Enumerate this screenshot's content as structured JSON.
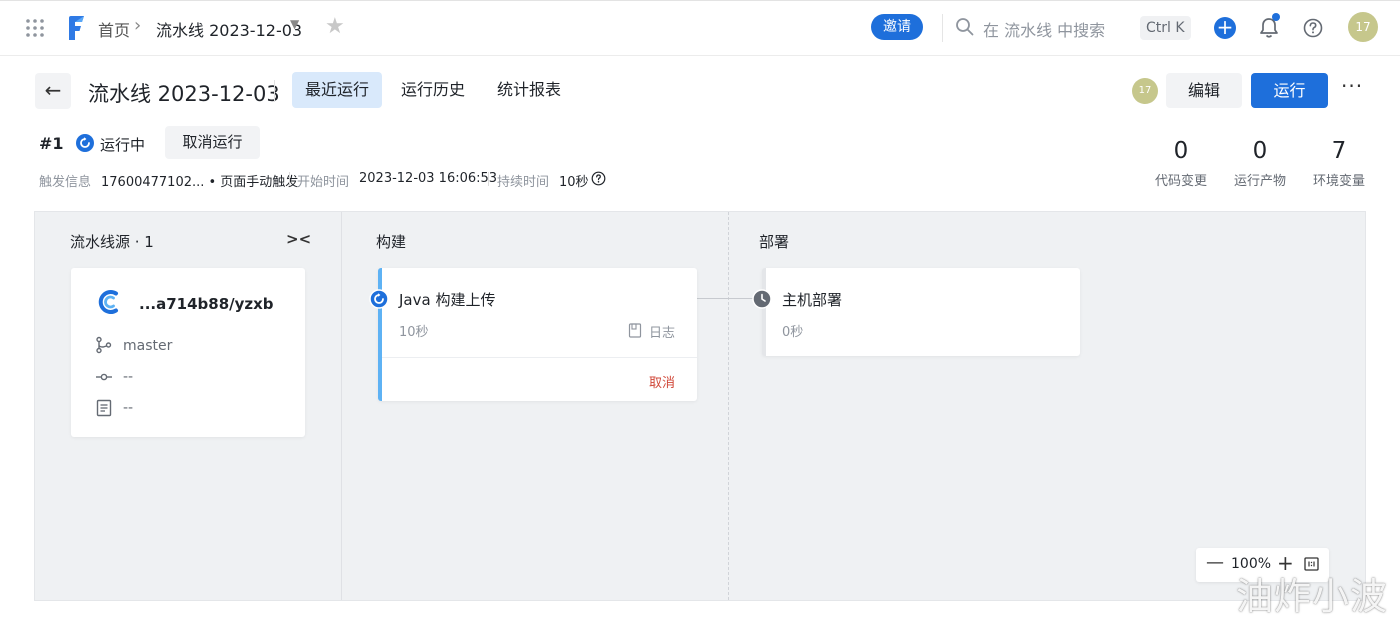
{
  "topbar": {
    "breadcrumb_home": "首页",
    "breadcrumb_separator": "›",
    "breadcrumb_current": "流水线 2023-12-03",
    "invite_label": "邀请",
    "search_placeholder": "在 流水线 中搜索",
    "shortcut": "Ctrl K",
    "add_label": "+",
    "avatar_text": "17",
    "accent_color": "#1e6fdb"
  },
  "header": {
    "back_label": "←",
    "title": "流水线 2023-12-03",
    "tabs": [
      {
        "label": "最近运行",
        "active": true
      },
      {
        "label": "运行历史",
        "active": false
      },
      {
        "label": "统计报表",
        "active": false
      }
    ],
    "avatar_text": "17",
    "edit_label": "编辑",
    "run_label": "运行",
    "more_label": "···"
  },
  "run": {
    "number": "#1",
    "status": "运行中",
    "cancel_label": "取消运行",
    "trigger_label": "触发信息",
    "trigger_value": "17600477102... • 页面手动触发",
    "start_label": "开始时间",
    "start_value": "2023-12-03 16:06:53",
    "duration_label": "持续时间",
    "duration_value": "10秒",
    "stats": [
      {
        "value": "0",
        "label": "代码变更"
      },
      {
        "value": "0",
        "label": "运行产物"
      },
      {
        "value": "7",
        "label": "环境变量"
      }
    ]
  },
  "pipeline": {
    "columns": [
      {
        "title": "流水线源 · 1",
        "collapse_icon": "><"
      },
      {
        "title": "构建"
      },
      {
        "title": "部署"
      }
    ],
    "source": {
      "repo_name": "...a714b88/yzxb",
      "branch": "master",
      "commit": "--",
      "message": "--"
    },
    "build_job": {
      "title": "Java 构建上传",
      "duration": "10秒",
      "log_label": "日志",
      "cancel_label": "取消",
      "status": "running"
    },
    "deploy_job": {
      "title": "主机部署",
      "duration": "0秒",
      "status": "pending"
    },
    "zoom": {
      "minus": "—",
      "value": "100%",
      "plus": "+"
    }
  },
  "watermark": "油炸小波"
}
